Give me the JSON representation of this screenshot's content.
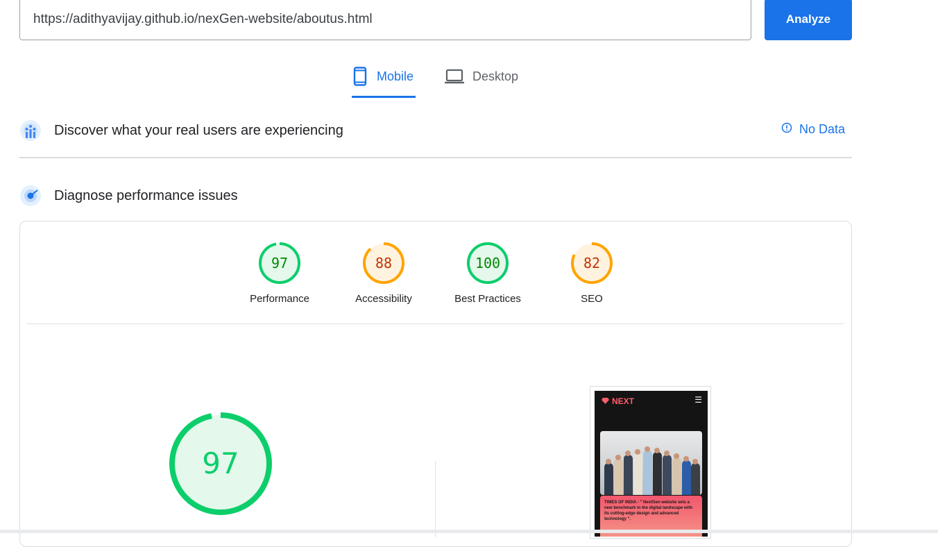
{
  "search": {
    "url": "https://adithyavijay.github.io/nexGen-website/aboutus.html",
    "analyze_label": "Analyze"
  },
  "tabs": [
    {
      "label": "Mobile",
      "active": true
    },
    {
      "label": "Desktop",
      "active": false
    }
  ],
  "field_data": {
    "title": "Discover what your real users are experiencing",
    "status": "No Data"
  },
  "lab_data": {
    "title": "Diagnose performance issues",
    "scores": [
      {
        "label": "Performance",
        "score": "97",
        "color": "#0cce6b",
        "text_color": "#008800",
        "fill": "#e5f8ec"
      },
      {
        "label": "Accessibility",
        "score": "88",
        "color": "#ffa400",
        "text_color": "#c33300",
        "fill": "#fff3e0"
      },
      {
        "label": "Best Practices",
        "score": "100",
        "color": "#0cce6b",
        "text_color": "#008800",
        "fill": "#e5f8ec"
      },
      {
        "label": "SEO",
        "score": "82",
        "color": "#ffa400",
        "text_color": "#c33300",
        "fill": "#fff3e0"
      }
    ],
    "main_score": "97"
  },
  "preview": {
    "logo": "NEXT",
    "quote": "TIMES OF INDIA - \" NextGen website sets a new benchmark in the digital landscape with its cutting-edge design and advanced technology \"."
  },
  "colors": {
    "accent": "#1a73e8",
    "pass": "#0cce6b",
    "average": "#ffa400"
  }
}
